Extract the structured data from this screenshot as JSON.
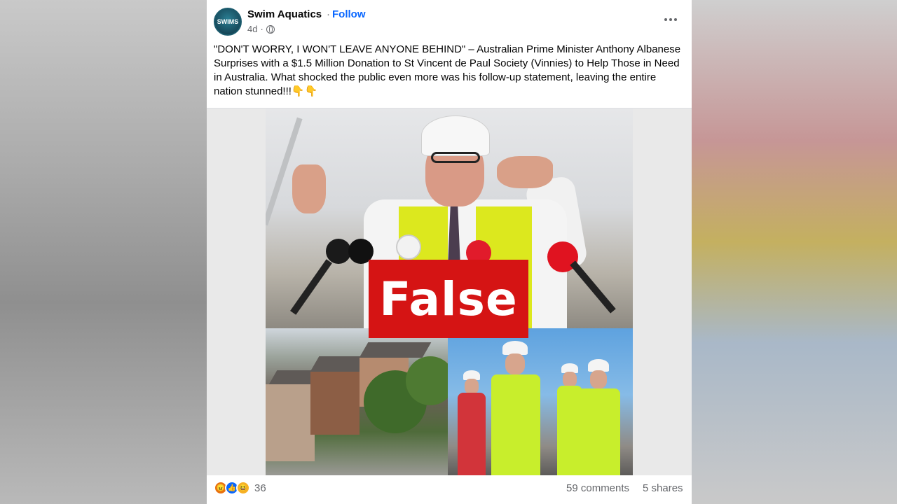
{
  "post": {
    "page_name": "Swim Aquatics",
    "separator": "·",
    "follow_label": "Follow",
    "time_ago": "4d",
    "avatar_text": "SWIMS",
    "text": "\"DON'T WORRY, I WON'T LEAVE ANYONE BEHIND\" – Australian Prime Minister Anthony Albanese Surprises with a $1.5 Million Donation to St Vincent de Paul Society (Vinnies) to Help Those in Need in Australia. What shocked the public even more was his follow-up statement, leaving the entire nation stunned!!!👇👇",
    "overlay_label": "False"
  },
  "footer": {
    "reaction_count": "36",
    "comments": "59 comments",
    "shares": "5 shares"
  },
  "icons": {
    "privacy": "globe-icon",
    "more": "more-options-icon",
    "reactions": [
      "angry-icon",
      "like-icon",
      "haha-icon"
    ]
  },
  "colors": {
    "accent": "#0866ff",
    "false_label_bg": "#d51414",
    "secondary_text": "#65676b"
  }
}
